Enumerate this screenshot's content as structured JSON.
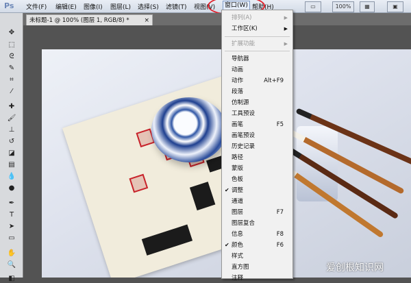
{
  "app": {
    "logo": "Ps"
  },
  "menubar": {
    "items": [
      "文件(F)",
      "编辑(E)",
      "图像(I)",
      "图层(L)",
      "选择(S)",
      "滤镜(T)",
      "视图(V)",
      "窗口(W)",
      "帮助(H)"
    ]
  },
  "right_tools": {
    "zoom_label": "100%",
    "arrange": "▾"
  },
  "document": {
    "tab_title": "未标题-1 @ 100% (图层 1, RGB/8) *",
    "close": "×"
  },
  "window_menu": {
    "top_items": [
      {
        "label": "排列(A)",
        "submenu": true
      },
      {
        "label": "工作区(K)",
        "submenu": true
      },
      {
        "label": "扩展功能",
        "submenu": true
      }
    ],
    "panels": [
      {
        "label": "导航器",
        "shortcut": ""
      },
      {
        "label": "动画",
        "shortcut": ""
      },
      {
        "label": "动作",
        "shortcut": "Alt+F9"
      },
      {
        "label": "段落",
        "shortcut": ""
      },
      {
        "label": "仿制源",
        "shortcut": ""
      },
      {
        "label": "工具预设",
        "shortcut": ""
      },
      {
        "label": "画笔",
        "shortcut": "F5"
      },
      {
        "label": "画笔预设",
        "shortcut": ""
      },
      {
        "label": "历史记录",
        "shortcut": ""
      },
      {
        "label": "路径",
        "shortcut": ""
      },
      {
        "label": "蒙版",
        "shortcut": ""
      },
      {
        "label": "色板",
        "shortcut": ""
      },
      {
        "label": "调整",
        "shortcut": "",
        "checked": true
      },
      {
        "label": "通道",
        "shortcut": ""
      },
      {
        "label": "图层",
        "shortcut": "F7"
      },
      {
        "label": "图层复合",
        "shortcut": ""
      },
      {
        "label": "信息",
        "shortcut": "F8"
      },
      {
        "label": "颜色",
        "shortcut": "F6",
        "checked": true
      },
      {
        "label": "样式",
        "shortcut": ""
      },
      {
        "label": "直方图",
        "shortcut": ""
      },
      {
        "label": "注释",
        "shortcut": ""
      }
    ],
    "check_mark": "✔",
    "submenu_arrow": "▶"
  },
  "watermark": {
    "text": "爱创根知识网"
  },
  "colors": {
    "highlight_circle": "#e0202a",
    "menu_bg": "#f1f1f1"
  }
}
